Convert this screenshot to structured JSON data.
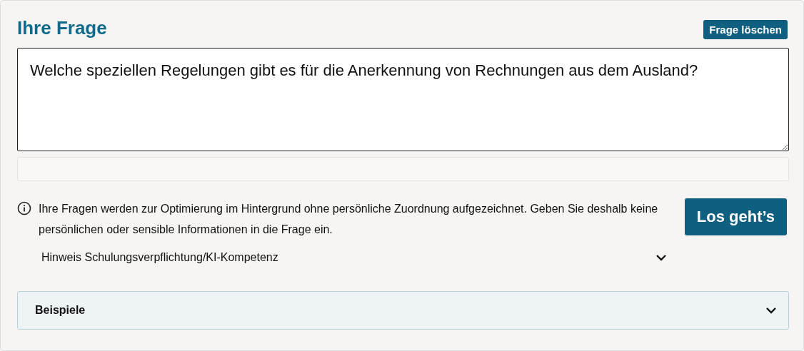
{
  "title": "Ihre Frage",
  "clear_button": "Frage löschen",
  "question": {
    "value": "Welche speziellen Regelungen gibt es für die Anerkennung von Rechnungen aus dem Ausland?"
  },
  "notice": "Ihre Fragen werden zur Optimierung im Hintergrund ohne persönliche Zuordnung aufgezeichnet. Geben Sie deshalb keine persönlichen oder sensible Informationen in die Frage ein.",
  "submit_button": "Los geht’s",
  "hint": {
    "label": "Hinweis Schulungsverpflichtung/KI-Kompetenz",
    "expanded": false
  },
  "examples": {
    "label": "Beispiele",
    "expanded": false
  }
}
